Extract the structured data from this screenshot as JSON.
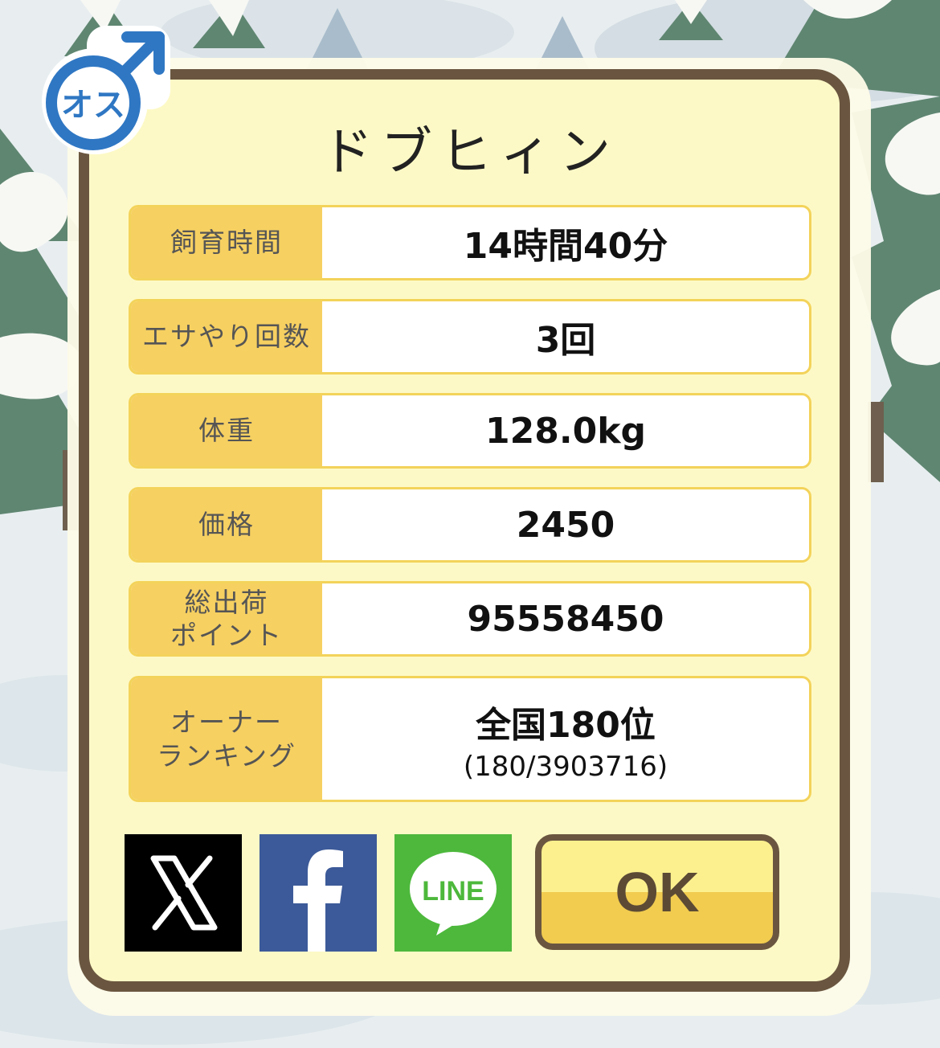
{
  "creature": {
    "name": "ドブヒィン",
    "gender_badge_text": "オス",
    "gender_icon": "male-symbol-icon"
  },
  "stats": [
    {
      "label": "飼育時間",
      "value": "14時間40分"
    },
    {
      "label": "エサやり回数",
      "value": "3回"
    },
    {
      "label": "体重",
      "value": "128.0kg"
    },
    {
      "label": "価格",
      "value": "2450"
    },
    {
      "label": "総出荷\nポイント",
      "value": "95558450"
    },
    {
      "label": "オーナー\nランキング",
      "value": "全国180位",
      "sub": "(180/3903716)"
    }
  ],
  "share": {
    "x_icon": "x-logo-icon",
    "facebook_icon": "facebook-logo-icon",
    "line_icon": "line-logo-icon",
    "line_label": "LINE"
  },
  "ok_label": "OK",
  "colors": {
    "panel_bg": "#fdf9c6",
    "panel_border": "#6a5640",
    "label_bg": "#f6d061",
    "male_blue": "#2f77c3",
    "facebook": "#3c5a99",
    "line": "#4db83c",
    "ok_top": "#fcf08e",
    "ok_bottom": "#f1cc4f"
  }
}
